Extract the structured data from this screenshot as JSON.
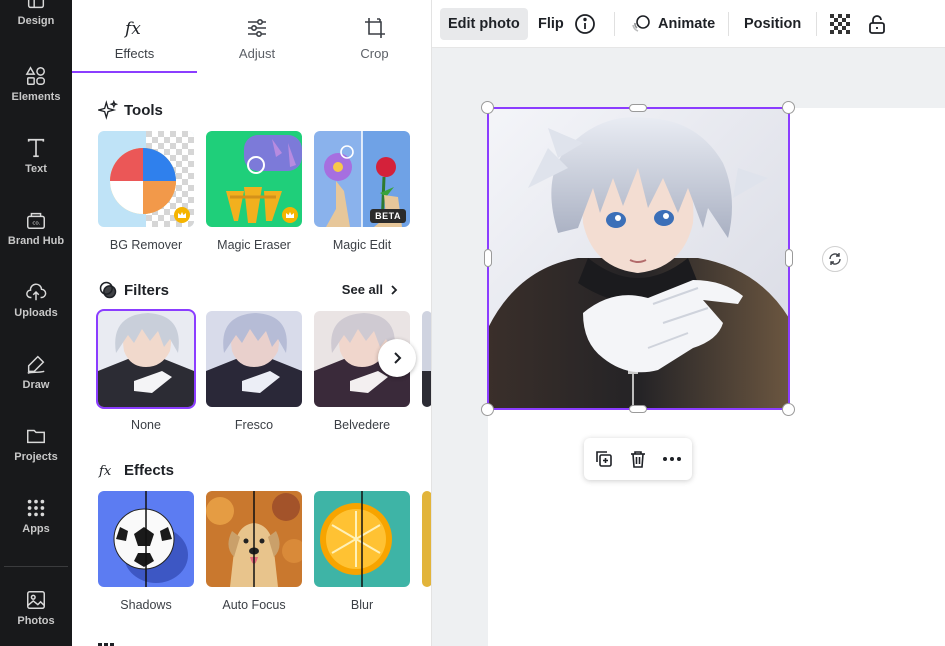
{
  "rail": {
    "items": [
      {
        "label": "Design",
        "icon": "design-icon"
      },
      {
        "label": "Elements",
        "icon": "elements-icon"
      },
      {
        "label": "Text",
        "icon": "text-icon"
      },
      {
        "label": "Brand Hub",
        "icon": "brand-hub-icon"
      },
      {
        "label": "Uploads",
        "icon": "upload-icon"
      },
      {
        "label": "Draw",
        "icon": "draw-icon"
      },
      {
        "label": "Projects",
        "icon": "folder-icon"
      },
      {
        "label": "Apps",
        "icon": "apps-icon"
      },
      {
        "label": "Photos",
        "icon": "photos-icon"
      }
    ]
  },
  "panel": {
    "tabs": [
      {
        "label": "Effects",
        "icon": "fx-icon",
        "active": true
      },
      {
        "label": "Adjust",
        "icon": "sliders-icon",
        "active": false
      },
      {
        "label": "Crop",
        "icon": "crop-icon",
        "active": false
      }
    ],
    "tools": {
      "title": "Tools",
      "items": [
        {
          "label": "BG Remover",
          "badge": "crown"
        },
        {
          "label": "Magic Eraser",
          "badge": "crown"
        },
        {
          "label": "Magic Edit",
          "badge": "BETA"
        }
      ]
    },
    "filters": {
      "title": "Filters",
      "see_all": "See all",
      "items": [
        {
          "label": "None",
          "selected": true
        },
        {
          "label": "Fresco",
          "selected": false
        },
        {
          "label": "Belvedere",
          "selected": false
        }
      ]
    },
    "effects": {
      "title": "Effects",
      "items": [
        {
          "label": "Shadows"
        },
        {
          "label": "Auto Focus"
        },
        {
          "label": "Blur"
        }
      ]
    }
  },
  "toolbar": {
    "edit_photo": "Edit photo",
    "flip": "Flip",
    "animate": "Animate",
    "position": "Position"
  },
  "colors": {
    "accent": "#8b3dff",
    "rail_bg": "#18191b",
    "canvas_bg": "#eef0f2"
  }
}
